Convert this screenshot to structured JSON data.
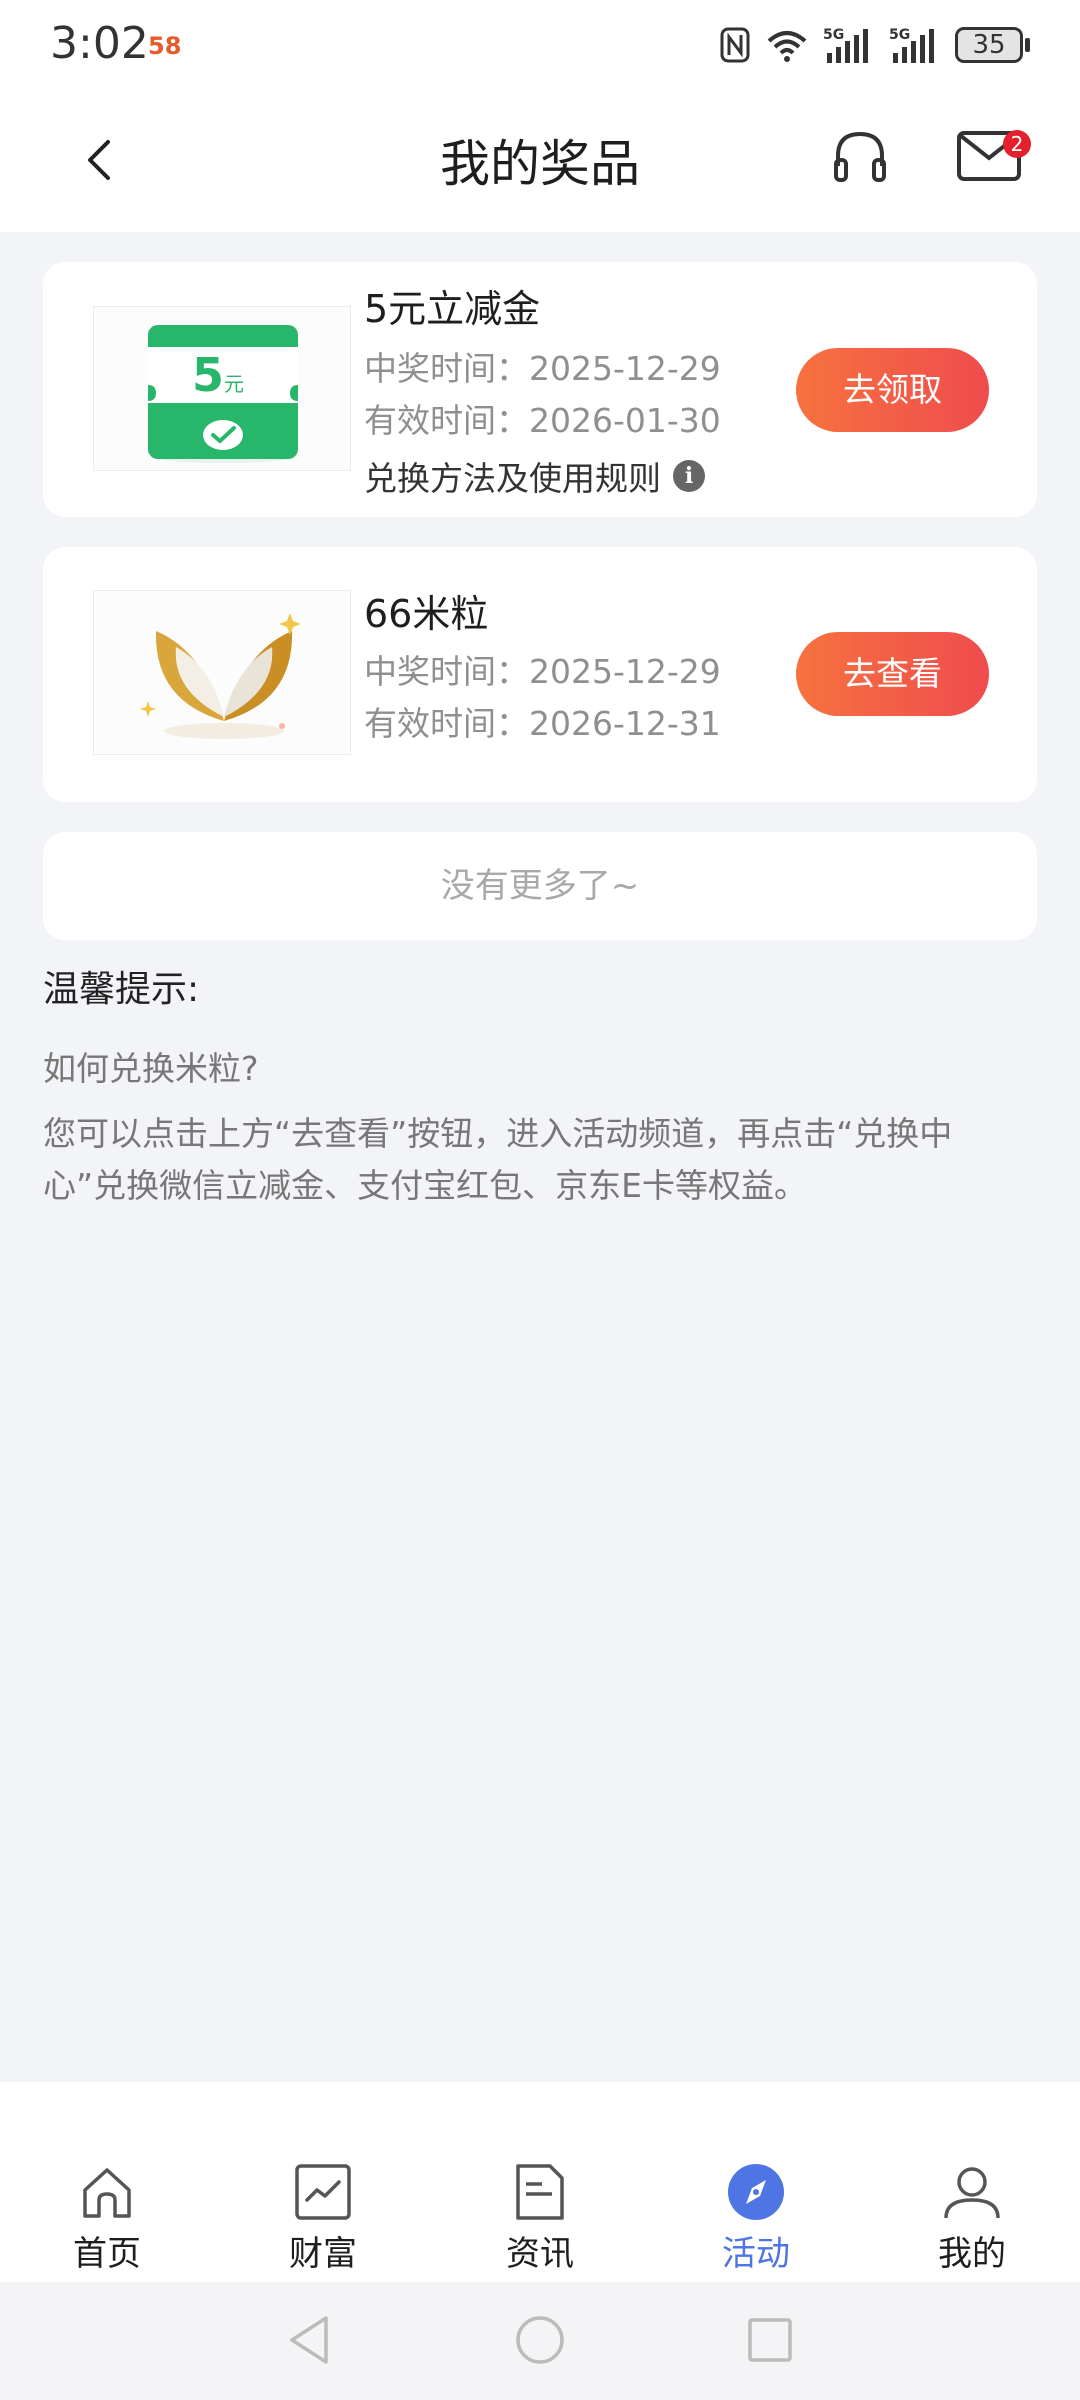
{
  "status_bar": {
    "time": "3:02",
    "app_badge": "58",
    "battery": "35"
  },
  "header": {
    "title": "我的奖品",
    "mail_badge": "2"
  },
  "prizes": [
    {
      "name": "5元立减金",
      "win_time": "中奖时间：2025-12-29",
      "valid_time": "有效时间：2026-01-30",
      "rule_link": "兑换方法及使用规则",
      "action": "去领取",
      "thumb_text": "5",
      "thumb_unit": "元"
    },
    {
      "name": "66米粒",
      "win_time": "中奖时间：2025-12-29",
      "valid_time": "有效时间：2026-12-31",
      "action": "去查看"
    }
  ],
  "no_more": "没有更多了~",
  "tips": {
    "title": "温馨提示:",
    "question": "如何兑换米粒?",
    "answer": "您可以点击上方“去查看”按钮，进入活动频道，再点击“兑换中心”兑换微信立减金、支付宝红包、京东E卡等权益。"
  },
  "bottom_nav": {
    "items": [
      {
        "label": "首页",
        "icon": "home-icon"
      },
      {
        "label": "财富",
        "icon": "chart-icon"
      },
      {
        "label": "资讯",
        "icon": "news-icon"
      },
      {
        "label": "活动",
        "icon": "compass-icon"
      },
      {
        "label": "我的",
        "icon": "user-icon"
      }
    ],
    "active_color": "#4f74e3"
  },
  "colors": {
    "button_gradient_start": "#f7723f",
    "button_gradient_end": "#ef4c4d",
    "page_bg": "#f3f4f8"
  }
}
